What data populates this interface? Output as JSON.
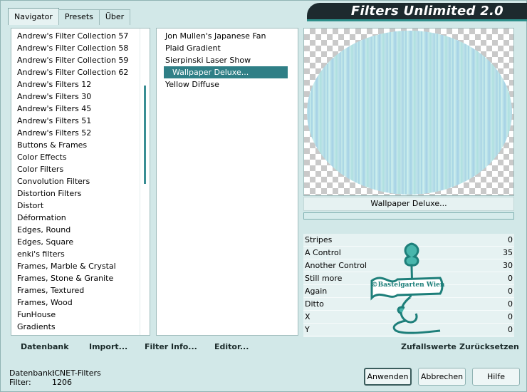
{
  "tabs": [
    {
      "label": "Navigator"
    },
    {
      "label": "Presets"
    },
    {
      "label": "Über"
    }
  ],
  "banner": {
    "title": "Filters Unlimited 2.0"
  },
  "categories": [
    "Andrew's Filter Collection 57",
    "Andrew's Filter Collection 58",
    "Andrew's Filter Collection 59",
    "Andrew's Filter Collection 62",
    "Andrew's Filters 12",
    "Andrew's Filters 30",
    "Andrew's Filters 45",
    "Andrew's Filters 51",
    "Andrew's Filters 52",
    "Buttons & Frames",
    "Color Effects",
    "Color Filters",
    "Convolution Filters",
    "Distortion Filters",
    "Distort",
    "Déformation",
    "Edges, Round",
    "Edges, Square",
    "enki's filters",
    "Frames, Marble & Crystal",
    "Frames, Stone & Granite",
    "Frames, Textured",
    "Frames, Wood",
    "FunHouse",
    "Gradients"
  ],
  "filters": [
    "Jon Mullen's Japanese Fan",
    "Plaid Gradient",
    "Sierpinski Laser Show",
    "Wallpaper Deluxe...",
    "Yellow Diffuse"
  ],
  "selected_filter": "Wallpaper Deluxe...",
  "preview": {
    "filter_name": "Wallpaper Deluxe..."
  },
  "params": [
    {
      "label": "Stripes",
      "value": "0"
    },
    {
      "label": "A Control",
      "value": "35"
    },
    {
      "label": "Another Control",
      "value": "30"
    },
    {
      "label": "Still more",
      "value": "0"
    },
    {
      "label": "Again",
      "value": "0"
    },
    {
      "label": "Ditto",
      "value": "0"
    },
    {
      "label": "X",
      "value": "0"
    },
    {
      "label": "Y",
      "value": "0"
    }
  ],
  "watermark": {
    "text": "©Bastelgarten Wien"
  },
  "linkbar": {
    "database": "Datenbank",
    "import": "Import...",
    "filter_info": "Filter Info...",
    "editor": "Editor...",
    "random": "Zufallswerte",
    "reset": "Zurücksetzen"
  },
  "status": {
    "database_label": "Datenbank:",
    "database_value": "ICNET-Filters",
    "filter_label": "Filter:",
    "filter_value": "1206"
  },
  "buttons": {
    "apply": "Anwenden",
    "cancel": "Abbrechen",
    "help": "Hilfe"
  },
  "colors": {
    "window_bg": "#d2e8e8",
    "selection": "#2f7f86",
    "banner_bg": "#1d2a2e",
    "accent": "#2c8f8a"
  }
}
